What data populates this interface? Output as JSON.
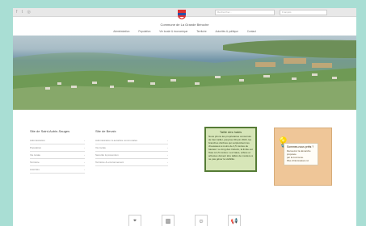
{
  "header": {
    "social": "f  t  ◎",
    "search_placeholder": "Rechercher...",
    "lang_placeholder": "Français"
  },
  "brand": {
    "title": "Commune de La Grande Béroche"
  },
  "nav": {
    "items": [
      "Administration",
      "Population",
      "Vie locale & économique",
      "Territoire",
      "Autorités & politique",
      "Contact"
    ]
  },
  "left_list": {
    "title": "Site de Saint-Aubin-Sauges",
    "items": [
      "Administration",
      "Population",
      "Vie locale",
      "Territoire",
      "Autorités"
    ]
  },
  "right_list": {
    "title": "Site de Bevaix",
    "items": [
      "Administration & autorités communales",
      "Vie locale",
      "Sécurité & prévention",
      "Territoire & environnement"
    ]
  },
  "bulletin": {
    "title": "Taille des haies",
    "text": "Nous prions les propriétaires concernés de bien tailler, jusqu'au 30 juin 2022, les branches d'arbres qui surplombent les chaussées à moins de 4,5 mètres de hauteur. Le long des trottoirs, la limite est fixée à 2,5 mètres. Les haies, arbres et arbustes doivent être taillés de manière à ne pas gêner la visibilité."
  },
  "note": {
    "title": "Sommes-nous prêts ?",
    "lines": [
      "Découvrez la démarche proposée",
      "par la commune.",
      "Plus d'informations ici"
    ]
  },
  "footer": {
    "icons": [
      "location-icon",
      "building-icon",
      "person-icon",
      "megaphone-icon"
    ]
  },
  "colors": {
    "background": "#a9ded4",
    "bulletin_border": "#557b35",
    "note_bg": "#efc698"
  }
}
